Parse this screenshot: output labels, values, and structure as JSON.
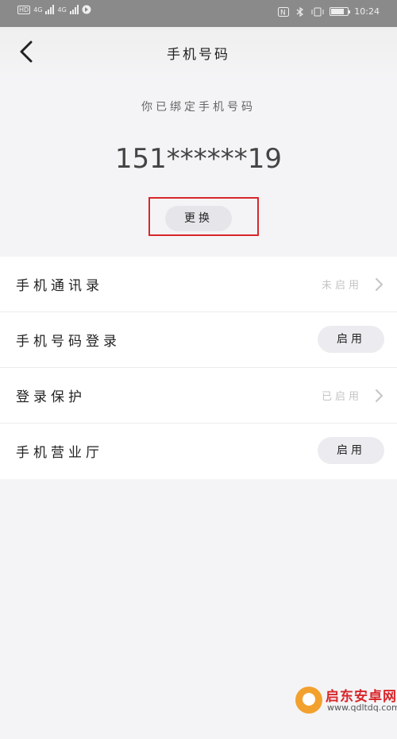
{
  "status_bar": {
    "network_left": "4G",
    "network_right": "4G",
    "time": "10:24",
    "battery_level": "72"
  },
  "nav": {
    "title": "手机号码"
  },
  "binding": {
    "subtitle": "你已绑定手机号码",
    "phone_number": "151******19",
    "change_label": "更换"
  },
  "settings": [
    {
      "label": "手机通讯录",
      "status": "未启用",
      "action": "chevron"
    },
    {
      "label": "手机号码登录",
      "button_label": "启用",
      "action": "button"
    },
    {
      "label": "登录保护",
      "status": "已启用",
      "action": "chevron"
    },
    {
      "label": "手机营业厅",
      "button_label": "启用",
      "action": "button"
    }
  ],
  "watermark": {
    "brand": "启东安卓网",
    "url": "www.qdltdq.com"
  },
  "colors": {
    "highlight": "#d8262a",
    "accent_logo": "#f2a12e"
  }
}
